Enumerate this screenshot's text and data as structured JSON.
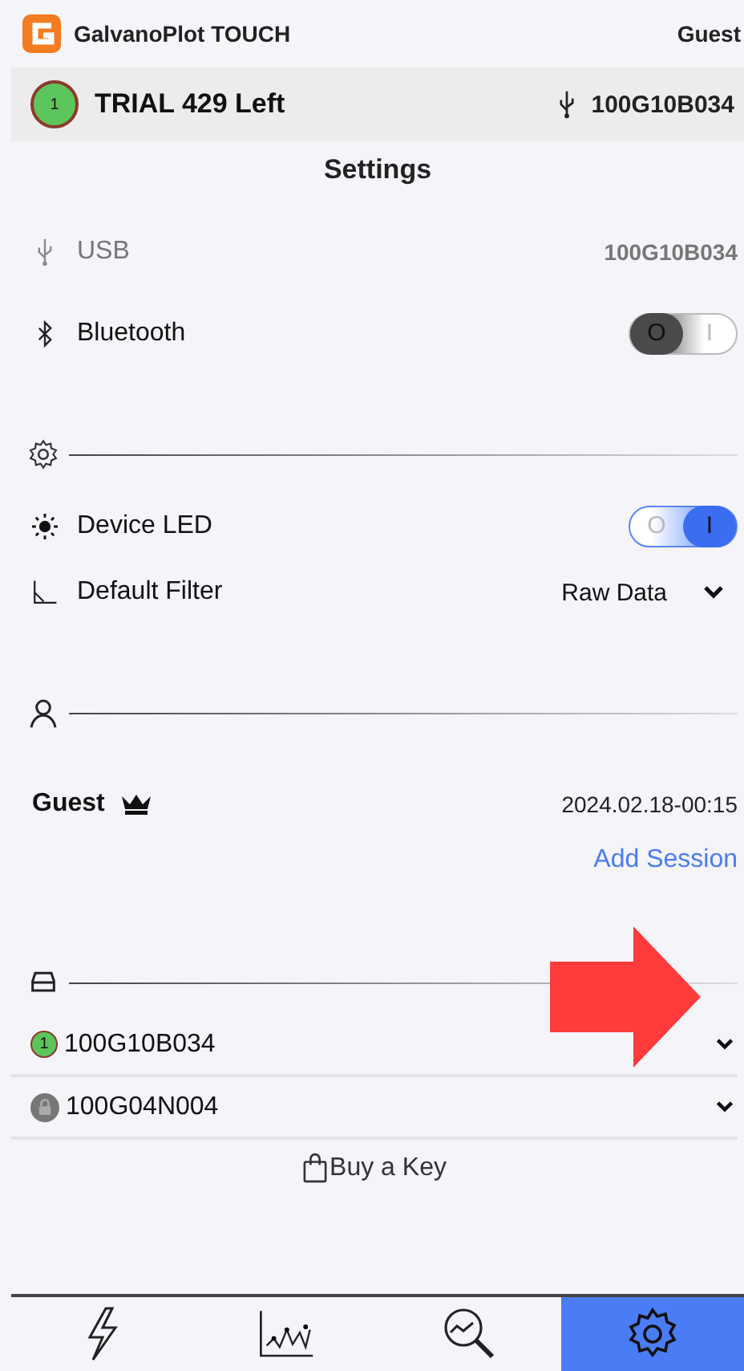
{
  "app_bar": {
    "title": "GalvanoPlot TOUCH",
    "user": "Guest"
  },
  "device_bar": {
    "badge": "1",
    "name": "TRIAL 429 Left",
    "serial": "100G10B034"
  },
  "page_title": "Settings",
  "connection": {
    "usb_label": "USB",
    "usb_value": "100G10B034",
    "bluetooth_label": "Bluetooth",
    "bluetooth_toggle": {
      "on": false,
      "off_label": "O",
      "on_label": "I"
    }
  },
  "general": {
    "led_label": "Device LED",
    "led_toggle": {
      "on": true,
      "off_label": "O",
      "on_label": "I"
    },
    "filter_label": "Default Filter",
    "filter_value": "Raw Data"
  },
  "user": {
    "name": "Guest",
    "date": "2024.02.18-00:15",
    "link": "Add Session"
  },
  "devices": [
    {
      "kind": "active",
      "badge": "1",
      "name": "100G10B034"
    },
    {
      "kind": "locked",
      "name": "100G04N004"
    }
  ],
  "buy_key": "Buy a Key",
  "nav": [
    {
      "kind": "measure",
      "selected": false
    },
    {
      "kind": "chart",
      "selected": false
    },
    {
      "kind": "analysis",
      "selected": false
    },
    {
      "kind": "settings",
      "selected": true
    }
  ]
}
